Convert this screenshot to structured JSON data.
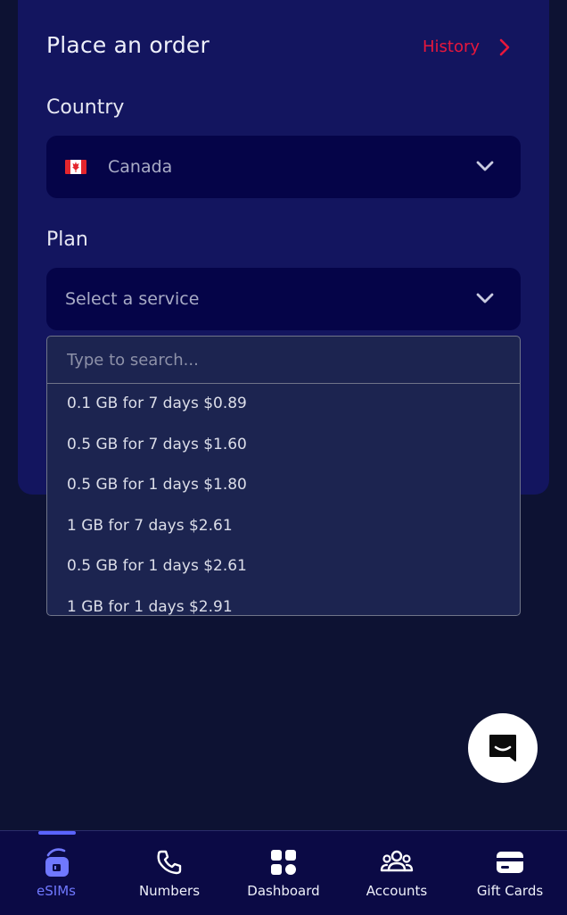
{
  "header": {
    "title": "Place an order",
    "history_label": "History"
  },
  "country": {
    "label": "Country",
    "selected": "Canada"
  },
  "plan": {
    "label": "Plan",
    "placeholder": "Select a service",
    "search_placeholder": "Type to search...",
    "options": [
      "0.1 GB for 7 days $0.89",
      "0.5 GB for 7 days $1.60",
      "0.5 GB for 1 days $1.80",
      "1 GB for 7 days $2.61",
      "0.5 GB for 1 days $2.61",
      "1 GB for 1 days $2.91"
    ]
  },
  "nav": {
    "active": "eSIMs",
    "items": [
      {
        "label": "eSIMs",
        "icon": "sim-card-icon"
      },
      {
        "label": "Numbers",
        "icon": "phone-icon"
      },
      {
        "label": "Dashboard",
        "icon": "dashboard-grid-icon"
      },
      {
        "label": "Accounts",
        "icon": "users-icon"
      },
      {
        "label": "Gift Cards",
        "icon": "gift-card-icon"
      }
    ]
  },
  "colors": {
    "accent": "#e8173c",
    "active_nav": "#7078ff",
    "card": "#13155f",
    "background": "#0d1233"
  }
}
